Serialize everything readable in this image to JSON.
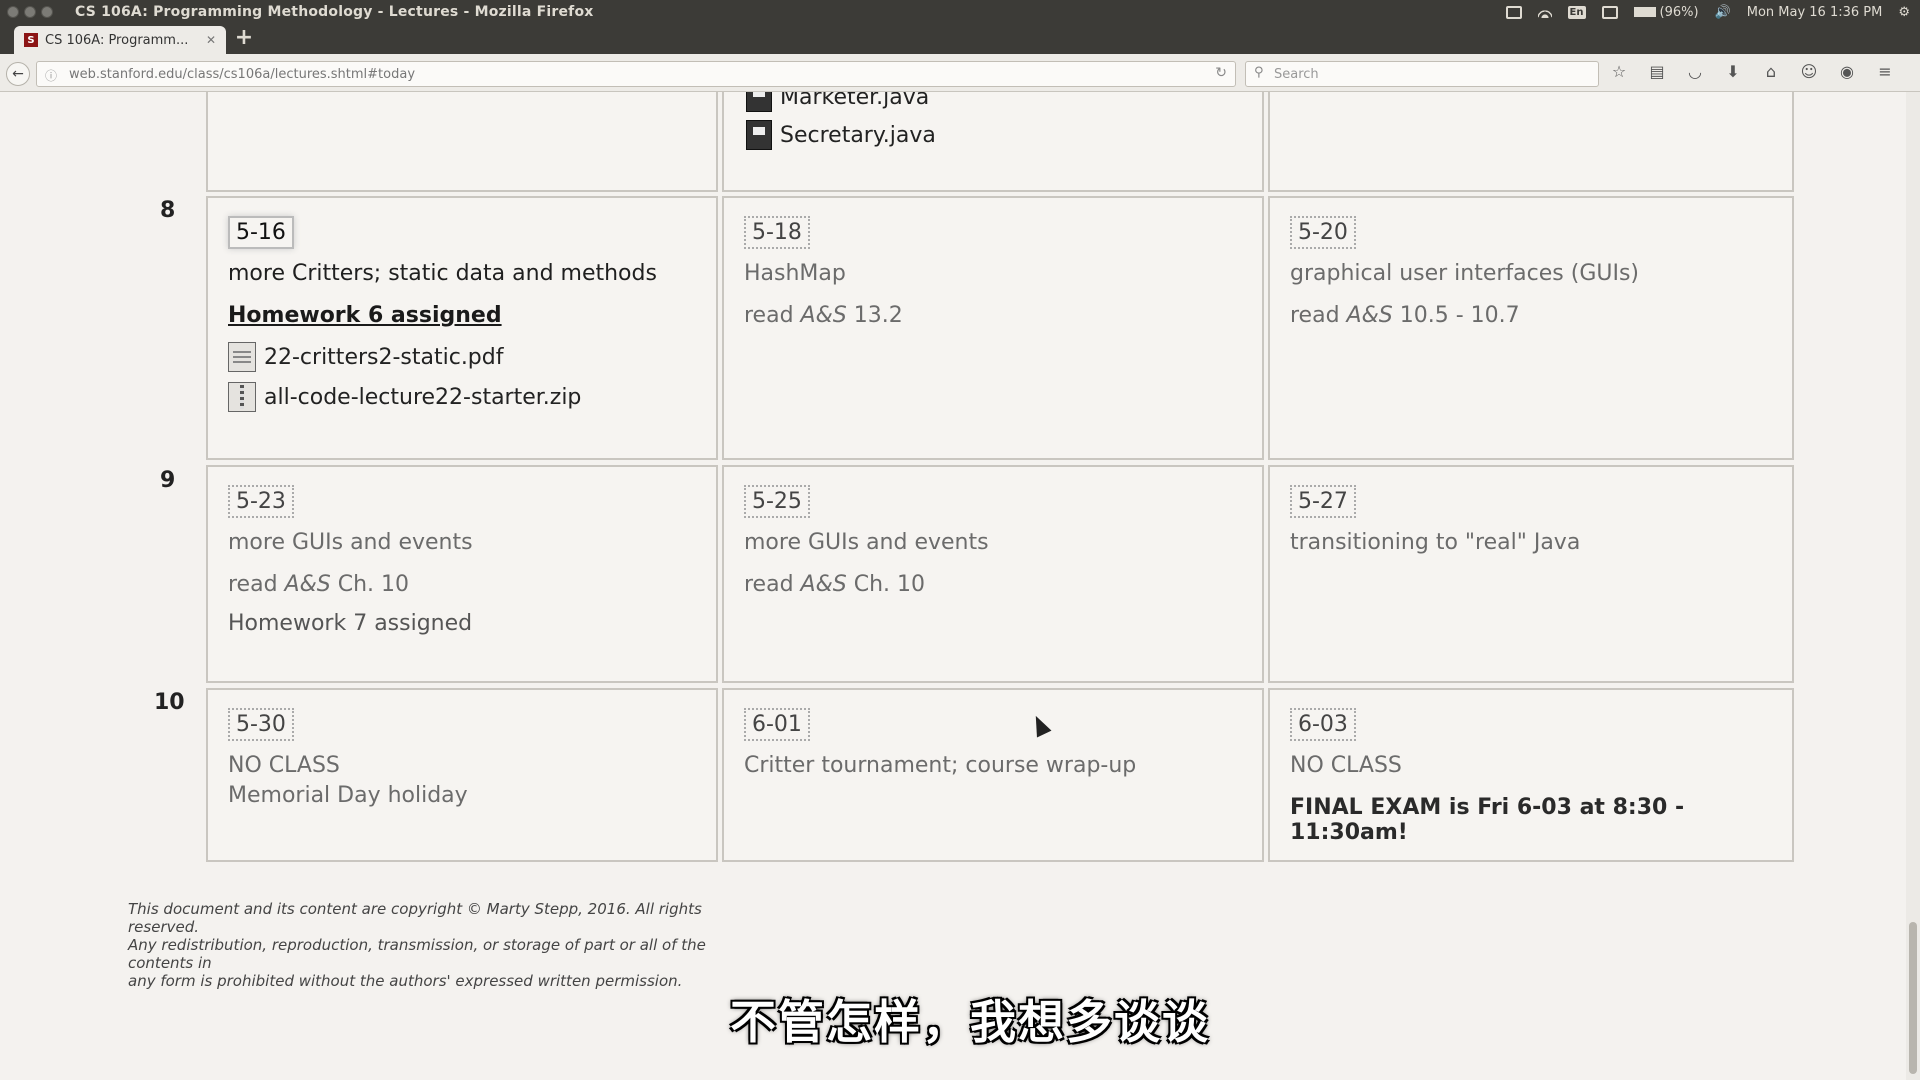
{
  "system_bar": {
    "window_title": "CS 106A: Programming Methodology - Lectures - Mozilla Firefox",
    "input_method": "En",
    "battery": "(96%)",
    "datetime": "Mon May 16  1:36 PM"
  },
  "browser": {
    "tab_title": "CS 106A: Programm...",
    "tab_favicon": "S",
    "url": "web.stanford.edu/class/cs106a/lectures.shtml#today",
    "search_placeholder": "Search"
  },
  "schedule": {
    "prev_week": {
      "files": [
        "Marketer.java",
        "Secretary.java"
      ]
    },
    "weeks": [
      {
        "number": "8",
        "days": [
          {
            "date": "5-16",
            "topic": "more Critters; static data and methods",
            "homework": "Homework 6 assigned",
            "files": [
              {
                "name": "22-critters2-static.pdf",
                "icon": "pdf-icon"
              },
              {
                "name": "all-code-lecture22-starter.zip",
                "icon": "zip-icon"
              }
            ]
          },
          {
            "date": "5-18",
            "topic": "HashMap",
            "reading_prefix": "read ",
            "reading_book": "A&S",
            "reading_suffix": " 13.2"
          },
          {
            "date": "5-20",
            "topic": "graphical user interfaces (GUIs)",
            "reading_prefix": "read ",
            "reading_book": "A&S",
            "reading_suffix": " 10.5 - 10.7"
          }
        ]
      },
      {
        "number": "9",
        "days": [
          {
            "date": "5-23",
            "topic": "more GUIs and events",
            "reading_prefix": "read ",
            "reading_book": "A&S",
            "reading_suffix": " Ch. 10",
            "homework": "Homework 7 assigned"
          },
          {
            "date": "5-25",
            "topic": "more GUIs and events",
            "reading_prefix": "read ",
            "reading_book": "A&S",
            "reading_suffix": " Ch. 10"
          },
          {
            "date": "5-27",
            "topic": "transitioning to \"real\" Java"
          }
        ]
      },
      {
        "number": "10",
        "days": [
          {
            "date": "5-30",
            "topic": "NO CLASS",
            "topic2": "Memorial Day holiday"
          },
          {
            "date": "6-01",
            "topic": "Critter tournament; course wrap-up"
          },
          {
            "date": "6-03",
            "topic": "NO CLASS",
            "final": "FINAL EXAM is Fri 6-03 at 8:30 - 11:30am!"
          }
        ]
      }
    ]
  },
  "footer": {
    "line1": "This document and its content are copyright © Marty Stepp, 2016. All rights reserved.",
    "line2": "Any redistribution, reproduction, transmission, or storage of part or all of the contents in",
    "line3": "any form is prohibited without the authors' expressed written permission."
  },
  "subtitle": "不管怎样，我想多谈谈"
}
